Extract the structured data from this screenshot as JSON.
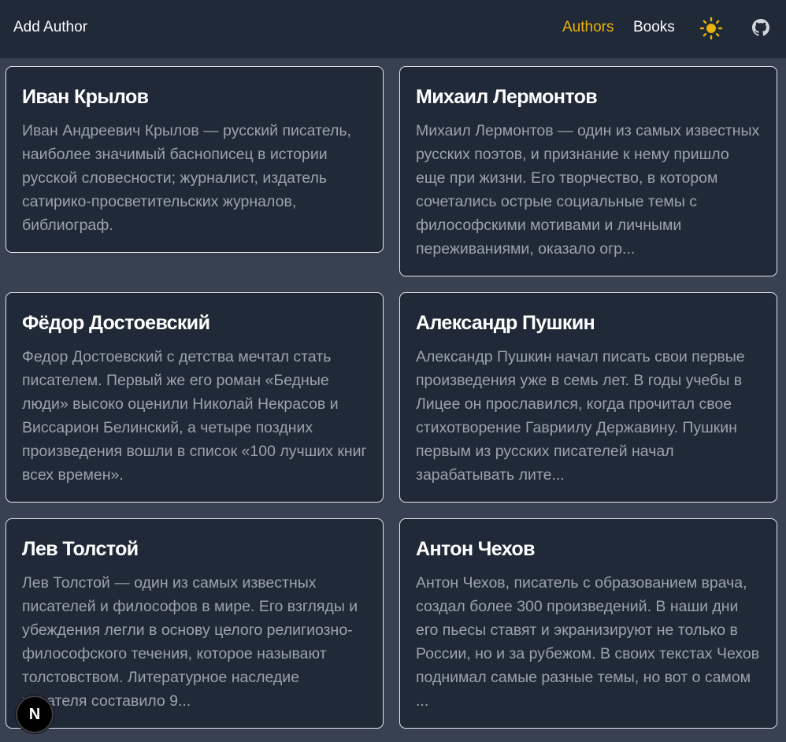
{
  "header": {
    "brand": "Add Author",
    "nav": {
      "authors": "Authors",
      "books": "Books"
    },
    "icons": {
      "theme": "sun-icon",
      "repo": "github-icon"
    },
    "accent": "#eab308"
  },
  "authors": [
    {
      "name": "Иван Крылов",
      "description": "Иван Андреевич Крылов — русский писатель, наиболее значимый баснописец в истории русской словесности; журналист, издатель сатирико-просветительских журналов, библиограф."
    },
    {
      "name": "Михаил Лермонтов",
      "description": "Михаил Лермонтов — один из самых известных русских поэтов, и признание к нему пришло еще при жизни. Его творчество, в котором сочетались острые социальные темы с философскими мотивами и личными переживаниями, оказало огр..."
    },
    {
      "name": "Фёдор Достоевский",
      "description": "Федор Достоевский с детства мечтал стать писателем. Первый же его роман «Бедные люди» высоко оценили Николай Некрасов и Виссарион Белинский, а четыре поздних произведения вошли в список «100 лучших книг всех времен»."
    },
    {
      "name": "Александр Пушкин",
      "description": "Александр Пушкин начал писать свои первые произведения уже в семь лет. В годы учебы в Лицее он прославился, когда прочитал свое стихотворение Гавриилу Державину. Пушкин первым из русских писателей начал зарабатывать лите..."
    },
    {
      "name": "Лев Толстой",
      "description": "Лев Толстой — один из самых известных писателей и философов в мире. Его взгляды и убеждения легли в основу целого религиозно-философского течения, которое называют толстовством. Литературное наследие писателя составило 9..."
    },
    {
      "name": "Антон Чехов",
      "description": "Антон Чехов, писатель с образованием врача, создал более 300 произведений. В наши дни его пьесы ставят и экранизируют не только в России, но и за рубежом. В своих текстах Чехов поднимал самые разные темы, но вот о самом ..."
    }
  ],
  "dev_badge": {
    "label": "N",
    "icon": "nextjs-icon"
  }
}
